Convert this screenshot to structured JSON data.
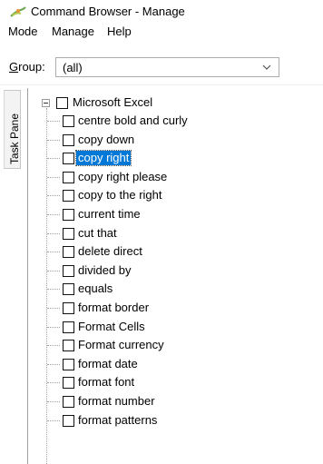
{
  "window": {
    "title": "Command Browser - Manage",
    "icon": "command-browser-icon"
  },
  "menu": [
    "Mode",
    "Manage",
    "Help"
  ],
  "group": {
    "label_accel": "G",
    "label_rest": "roup:",
    "selected_value": "(all)"
  },
  "task_pane": {
    "label": "Task Pane"
  },
  "tree": {
    "root": "Microsoft Excel",
    "selected_index": 2,
    "items": [
      "centre bold and curly",
      "copy down",
      "copy right",
      "copy right please",
      "copy to the right",
      "current time",
      "cut that",
      "delete direct",
      "divided by",
      "equals",
      "format border",
      "Format Cells",
      "Format currency",
      "format date",
      "format font",
      "format number",
      "format patterns"
    ]
  },
  "colors": {
    "selection": "#0078d7",
    "tree_line": "#a0a0a0"
  }
}
